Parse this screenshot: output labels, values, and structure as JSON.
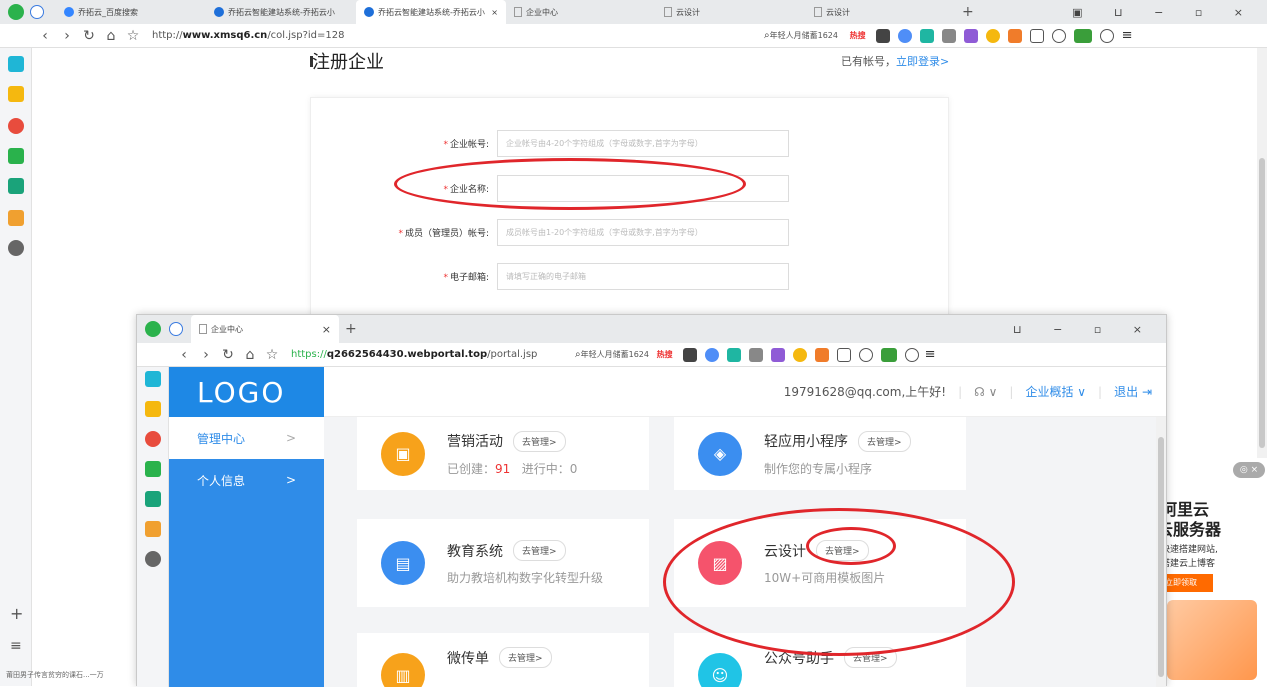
{
  "outer_browser": {
    "tabs": [
      {
        "label": "乔拓云_百度搜索",
        "active": false
      },
      {
        "label": "乔拓云智能建站系统-乔拓云小",
        "active": false
      },
      {
        "label": "乔拓云智能建站系统-乔拓云小",
        "active": true
      },
      {
        "label": "企业中心",
        "active": false
      },
      {
        "label": "云设计",
        "active": false
      },
      {
        "label": "云设计",
        "active": false
      }
    ],
    "new_tab": "+",
    "url_prefix": "http://",
    "url_domain": "www.xmsq6.cn",
    "url_path": "/col.jsp?id=128",
    "search_text": "年轻人月储蓄1624",
    "hot_label": "热搜",
    "status_text": "莆田男子传言贫穷的课石...一万"
  },
  "register_page": {
    "title": "注册企业",
    "login_hint": "已有帐号，",
    "login_link": "立即登录>",
    "fields": [
      {
        "label": "企业帐号:",
        "placeholder": "企业帐号由4-20个字符组成（字母或数字,首字为字母）"
      },
      {
        "label": "企业名称:",
        "placeholder": ""
      },
      {
        "label": "成员（管理员）帐号:",
        "placeholder": "成员帐号由1-20个字符组成（字母或数字,首字为字母）"
      },
      {
        "label": "电子邮箱:",
        "placeholder": "请填写正确的电子邮箱"
      }
    ]
  },
  "inner_browser": {
    "tab_label": "企业中心",
    "tab_close": "×",
    "new_tab": "+",
    "url_prefix": "https://",
    "url_domain": "q2662564430.webportal.top",
    "url_path": "/portal.jsp",
    "search_text": "年轻人月储蓄1624",
    "hot_label": "热搜"
  },
  "portal": {
    "logo": "LOGO",
    "nav": [
      {
        "label": "管理中心",
        "arrow": ">"
      },
      {
        "label": "个人信息",
        "arrow": ">"
      }
    ],
    "user_greeting": "19791628@qq.com,上午好!",
    "overview": "企业概括 ∨",
    "logout": "退出",
    "modules": [
      {
        "title": "营销活动",
        "button": "去管理>",
        "sub_prefix": "已创建：",
        "created": "91",
        "sub_mid": "进行中：",
        "ongoing": "0",
        "color": "#f7a21b"
      },
      {
        "title": "轻应用小程序",
        "button": "去管理>",
        "sub": "制作您的专属小程序",
        "color": "#3b8ef0"
      },
      {
        "title": "教育系统",
        "button": "去管理>",
        "sub": "助力教培机构数字化转型升级",
        "color": "#3b8ef0"
      },
      {
        "title": "云设计",
        "button": "去管理>",
        "sub": "10W+可商用模板图片",
        "color": "#f5536c"
      },
      {
        "title": "微传单",
        "button": "去管理>",
        "sub": "",
        "color": "#f7a21b"
      },
      {
        "title": "公众号助手",
        "button": "去管理>",
        "sub": "",
        "color": "#20c4e6"
      }
    ]
  },
  "ad": {
    "line1": "阿里云",
    "line2": "云服务器",
    "line3": "快速搭建网站,",
    "line4": "搭建云上博客",
    "cta": "立即领取"
  }
}
